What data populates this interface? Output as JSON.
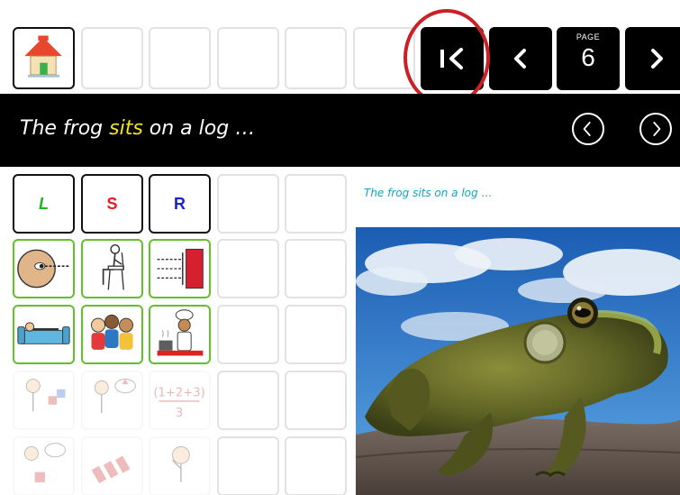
{
  "toolbar": {
    "home_icon": "home-icon",
    "first_page_icon": "first-page-icon",
    "prev_page_icon": "chevron-left-icon",
    "page_label": "PAGE",
    "page_number": "6",
    "next_page_icon": "chevron-right-icon"
  },
  "banner": {
    "before": "The frog ",
    "highlight": "sits",
    "after": " on a log …",
    "prev_icon": "circle-chevron-left-icon",
    "next_icon": "circle-chevron-right-icon"
  },
  "grid": {
    "letters": [
      {
        "text": "L",
        "color": "#22b51d"
      },
      {
        "text": "S",
        "color": "#e21d24"
      },
      {
        "text": "R",
        "color": "#1b22c6"
      }
    ]
  },
  "story": {
    "caption": "The frog sits on a log …"
  },
  "colors": {
    "highlight": "#f4e61c",
    "focus_ring": "#cc2027",
    "symbol_border": "#62c02d",
    "caption": "#13a3c1"
  }
}
